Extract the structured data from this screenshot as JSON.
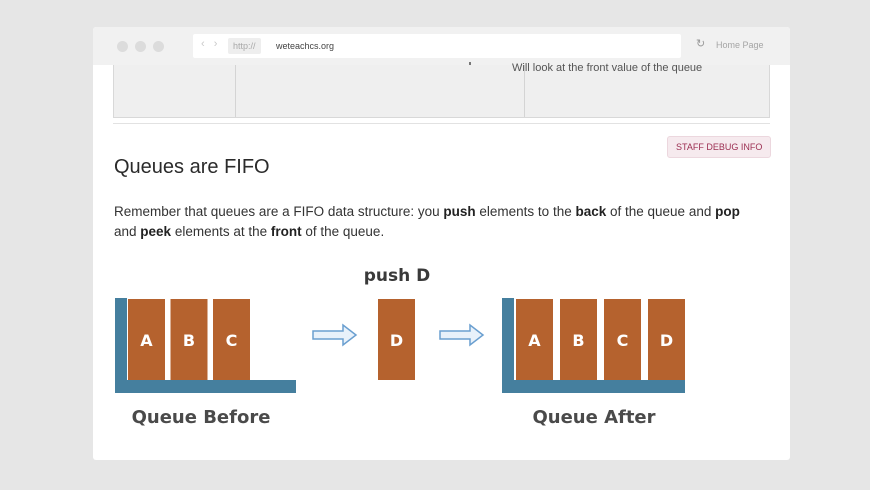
{
  "browser": {
    "protocol": "http://",
    "url": "weteachcs.org",
    "home_link": "Home Page",
    "nav_arrows": "‹ ›",
    "reload_icon": "↻"
  },
  "table": {
    "last_cell": "Will look at the front value of the queue"
  },
  "debug_button": "STAFF DEBUG INFO",
  "section": {
    "title": "Queues are FIFO",
    "paragraph": {
      "t1": "Remember that queues are a FIFO data structure: you ",
      "push": "push",
      "t2": " elements to the ",
      "back": "back",
      "t3": " of the queue and ",
      "pop": "pop",
      "t4": " and ",
      "peek": "peek",
      "t5": " elements at the ",
      "front": "front",
      "t6": " of the queue."
    }
  },
  "diagram": {
    "push_label": "push D",
    "before_caption": "Queue Before",
    "after_caption": "Queue After",
    "before_items": [
      "A",
      "B",
      "C"
    ],
    "pushed_item": "D",
    "after_items": [
      "A",
      "B",
      "C",
      "D"
    ],
    "colors": {
      "container": "#457f9e",
      "element": "#b5622e",
      "arrow_stroke": "#6a9fd0",
      "arrow_fill": "#e8f1fa",
      "caption": "#4a4a4a"
    }
  }
}
